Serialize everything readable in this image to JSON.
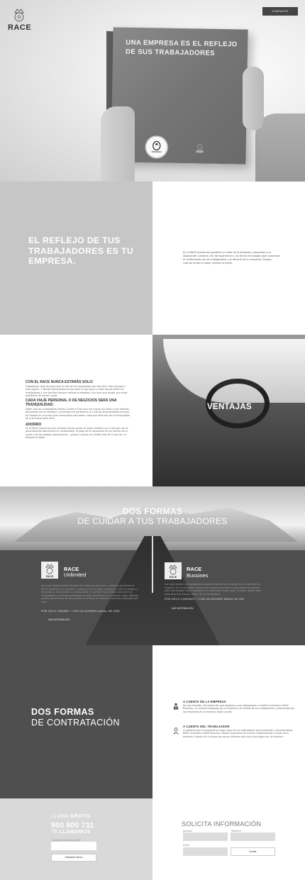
{
  "header": {
    "logo_text": "RACE",
    "contact_label": "CONTACTO"
  },
  "hero": {
    "book_title": "UNA EMPRESA ES EL REFLEJO DE SUS TRABAJADORES",
    "book_logo": "RACE"
  },
  "reflejo": {
    "title": "EL REFLEJO DE TUS TRABAJADORES ES TU EMPRESA.",
    "text": "En el RACE queremos ayudarle a cuidar de la empresa y ponemos a su disposición nuestros 100 de experiencia y la última tecnología para aumentar el rendimiento de sus trabajadores y la eficacia de su empresa. Porque, cuando lo das lo mejor recibes lo mejor."
  },
  "ventajas": {
    "title": "VENTAJAS",
    "items": [
      {
        "heading": "CON EL RACE NUNCA ESTARÁS SOLO:",
        "text": "Trabajamos cada día para que la vida de tus empleados sea más fácil. Más cómoda y más segura. Y damos tranquilidad de que pase lo que pase y estén donde estén tus trabajadores y sus familias siempre estarán protegidos. Eso hará que tengas que estar pendiente de menos cosas."
      },
      {
        "heading": "CADA VIAJE PERSONAL O DE NEGOCIOS SERÁ UNA TRANQUILIDAD:",
        "text": "Saber que tus trabajadores tienen a todo el Club que les mueve con ellos y que además, disfrutarán de las ventajas y privilegios de pertenecer al Club de Automovilistas primero en España en una sola gran comunidad para todos. Hará que disfrutes de la tranquilidad de lo principal para ellos."
      },
      {
        "heading": "AHORRO",
        "text": "En el RACE queremos que nuestros Socios ganen el mejor partido a su Cuota por eso le garantizamos descuentos en combustible, el pago de la reparación de las averías de tu coche y de las propias reparaciones... porque cuando uno recibe más de lo que da, se disfruta el doble."
      }
    ]
  },
  "dos_formas": {
    "title_bold": "DOS FORMAS",
    "title_light": "DE CUIDAR A TUS TRABAJADORES",
    "plans": [
      {
        "brand": "RACE",
        "name": "Unlimited",
        "desc": "Con esta tarjeta podrás disponer de todos los servicios y ventajas que ofrece el RACE: asistencia en carretera, asistencia en el hogar, asistencia jurídica, médica y tecnológica, descuentos en combustible y muchas más ventajas para que tus trabajadores se sientan protegidos en todo momento y en cualquier lugar. Además, podrán beneficiarse de descuentos exclusivos en talleres y servicios asociados del Club.",
        "price": "POR SÓLO 79€/AÑO + CON UN AHORRO ANUAL DE 225€",
        "more": "MÁS INFORMACIÓN"
      },
      {
        "brand": "RACE",
        "name": "Bussines",
        "desc": "Con esta tarjeta tus trabajadores podrán disfrutar de la asistencia en carretera en España y en el extranjero, además de asistencia jurídica y descuentos exclusivos para que puedan viajar tranquilos sin preocuparse por nada. La mejor opción para empresas que buscan cuidar de sus empleados.",
        "price": "POR SÓLO 4,95€/MES + CON UN AHORRO ANUAL DE 99€",
        "more": "MÁS INFORMACIÓN"
      }
    ]
  },
  "contratacion": {
    "title_bold": "DOS FORMAS",
    "title_light": "DE CONTRATACIÓN",
    "options": [
      {
        "icon": "business-icon",
        "heading": "A CUENTA DE LA EMPRESA",
        "text": "No más trámites. Dé protección que abastece a sus trabajadores a la RACE Unlimited o RACE Bussines, un contrato adaptado por la empresa a la medida de sus trabajadores y relacionado con los resultados de la empresa. Nada sucede."
      },
      {
        "icon": "person-icon",
        "heading": "A CUENTA DEL TRABAJADOR",
        "text": "Si prefieres que el empleado se haga cargo de sus trabajadores personalmente y recomendarles RACE Unlimited o RACE Bussines. Podrás contratarlo de manera independiente a través de tu empresa. Porque a tu lo pones por pocos céntimos más de lo que pagan por la empresa."
      }
    ]
  },
  "llamada": {
    "line1_light": "LLAMA",
    "line1_bold": "GRATIS",
    "phone": "900 800 731",
    "line2_light": "TE",
    "line2_bold": "LLAMAMOS",
    "input_label": "Escribe tu número de tlf.",
    "button": "Llámame ahora"
  },
  "solicita": {
    "title": "SOLICITA INFORMACIÓN",
    "nombre_label": "Nombre",
    "telefono_label": "Teléfono",
    "email_label": "Email",
    "button": "Enviar"
  }
}
